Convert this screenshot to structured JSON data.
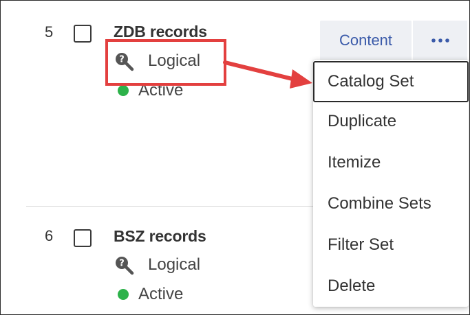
{
  "rows": [
    {
      "number": "5",
      "title": "ZDB records",
      "type_label": "Logical",
      "status_label": "Active"
    },
    {
      "number": "6",
      "title": "BSZ records",
      "type_label": "Logical",
      "status_label": "Active"
    }
  ],
  "actions": {
    "content_label": "Content",
    "more_icon": "ellipsis-icon"
  },
  "menu": {
    "items": [
      "Catalog Set",
      "Duplicate",
      "Itemize",
      "Combine Sets",
      "Filter Set",
      "Delete"
    ],
    "selected": "Catalog Set"
  },
  "colors": {
    "status_active": "#2db24a",
    "annotation": "#e3403f",
    "link": "#3a5aa9"
  },
  "icons": {
    "type_icon": "logical-search-icon",
    "status_icon": "status-dot-icon"
  }
}
